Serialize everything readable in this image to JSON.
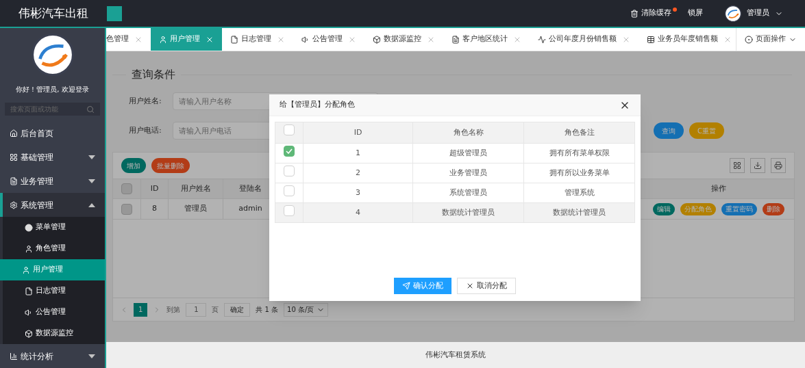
{
  "header": {
    "title": "伟彬汽车出租",
    "actions": [
      {
        "label": "清除缓存",
        "kind": "cache",
        "badge": true
      },
      {
        "label": "锁屏",
        "kind": "lock",
        "badge": false
      }
    ],
    "user": "管理员"
  },
  "sidebar": {
    "greeting": "你好！管理员, 欢迎登录",
    "search_placeholder": "搜索页面或功能",
    "items": [
      {
        "label": "后台首页",
        "kind": "link"
      },
      {
        "label": "基础管理",
        "kind": "group",
        "expanded": false
      },
      {
        "label": "业务管理",
        "kind": "group",
        "expanded": false
      },
      {
        "label": "系统管理",
        "kind": "group",
        "expanded": true,
        "children": [
          {
            "label": "菜单管理",
            "selected": false
          },
          {
            "label": "角色管理",
            "selected": false
          },
          {
            "label": "用户管理",
            "selected": true
          },
          {
            "label": "日志管理",
            "selected": false
          },
          {
            "label": "公告管理",
            "selected": false
          },
          {
            "label": "数据源监控",
            "selected": false
          }
        ]
      },
      {
        "label": "统计分析",
        "kind": "group",
        "expanded": false
      }
    ]
  },
  "tabs": [
    {
      "label": "色管理",
      "selected": false
    },
    {
      "label": "用户管理",
      "selected": true
    },
    {
      "label": "日志管理",
      "selected": false
    },
    {
      "label": "公告管理",
      "selected": false
    },
    {
      "label": "数据源监控",
      "selected": false
    },
    {
      "label": "客户地区统计",
      "selected": false
    },
    {
      "label": "公司年度月份销售额",
      "selected": false
    },
    {
      "label": "业务员年度销售额",
      "selected": false
    }
  ],
  "page_ops": "页面操作",
  "query": {
    "title": "查询条件",
    "fields": [
      {
        "label": "用户姓名:",
        "placeholder": "请输入用户名称"
      },
      {
        "label": "用户电话:",
        "placeholder": "请输入用户电话"
      }
    ],
    "search": "查询",
    "reset": "C重置"
  },
  "table": {
    "header_checked": false,
    "toolbar": [
      {
        "label": "增加",
        "kind": "add"
      },
      {
        "label": "批量删除",
        "kind": "delete"
      }
    ],
    "columns": [
      "ID",
      "用户姓名",
      "登陆名"
    ],
    "actions_column": "操作",
    "rows": [
      {
        "checked": false,
        "cells": [
          "8",
          "管理员",
          "admin"
        ],
        "actions": [
          {
            "label": "编辑",
            "kind": "edit"
          },
          {
            "label": "分配角色",
            "kind": "role"
          },
          {
            "label": "重置密码",
            "kind": "reset"
          },
          {
            "label": "删除",
            "kind": "delete"
          }
        ]
      }
    ]
  },
  "pagination": {
    "current": "1",
    "goto_label": "到第",
    "goto_value": "1",
    "page_label": "页",
    "confirm": "确定",
    "total": "共 1 条",
    "page_size": "10 条/页"
  },
  "modal": {
    "title": "给【管理员】分配角色",
    "header_checked": false,
    "columns": [
      "ID",
      "角色名称",
      "角色备注"
    ],
    "rows": [
      {
        "checked": true,
        "cells": [
          "1",
          "超级管理员",
          "拥有所有菜单权限"
        ]
      },
      {
        "checked": false,
        "cells": [
          "2",
          "业务管理员",
          "拥有所以业务菜单"
        ]
      },
      {
        "checked": false,
        "cells": [
          "3",
          "系统管理员",
          "管理系统"
        ]
      },
      {
        "checked": false,
        "cells": [
          "4",
          "数据统计管理员",
          "数据统计管理员"
        ]
      }
    ],
    "confirm": "确认分配",
    "cancel": "取消分配"
  },
  "footer": "伟彬汽车租赁系统"
}
